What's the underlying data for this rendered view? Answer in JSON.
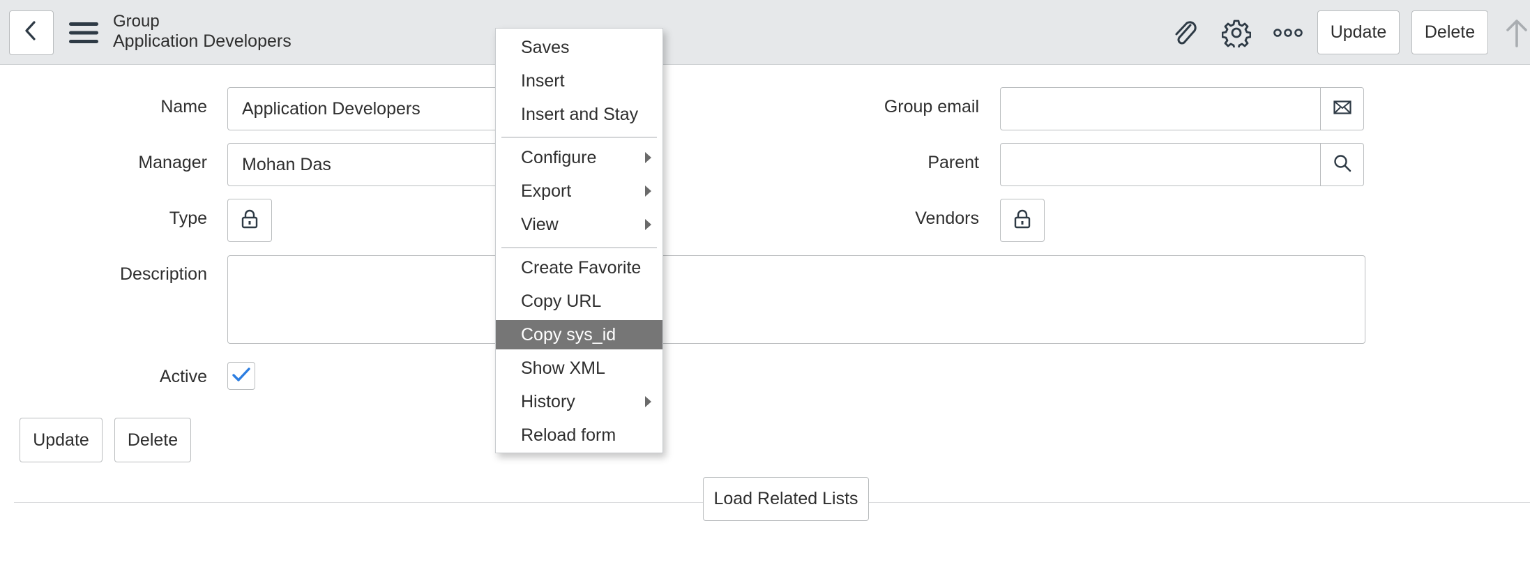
{
  "header": {
    "record_type": "Group",
    "record_name": "Application Developers",
    "update_label": "Update",
    "delete_label": "Delete"
  },
  "form": {
    "name_label": "Name",
    "name_value": "Application Developers",
    "manager_label": "Manager",
    "manager_value": "Mohan Das",
    "type_label": "Type",
    "description_label": "Description",
    "description_value": "",
    "active_label": "Active",
    "active_checked": true,
    "group_email_label": "Group email",
    "group_email_value": "",
    "parent_label": "Parent",
    "parent_value": "",
    "vendors_label": "Vendors",
    "update_label": "Update",
    "delete_label": "Delete",
    "load_related_label": "Load Related Lists"
  },
  "context_menu": {
    "items": [
      {
        "label": "Saves",
        "submenu": false,
        "highlighted": false
      },
      {
        "label": "Insert",
        "submenu": false,
        "highlighted": false
      },
      {
        "label": "Insert and Stay",
        "submenu": false,
        "highlighted": false
      },
      {
        "label": "Configure",
        "submenu": true,
        "highlighted": false
      },
      {
        "label": "Export",
        "submenu": true,
        "highlighted": false
      },
      {
        "label": "View",
        "submenu": true,
        "highlighted": false
      },
      {
        "label": "Create Favorite",
        "submenu": false,
        "highlighted": false
      },
      {
        "label": "Copy URL",
        "submenu": false,
        "highlighted": false
      },
      {
        "label": "Copy sys_id",
        "submenu": false,
        "highlighted": true
      },
      {
        "label": "Show XML",
        "submenu": false,
        "highlighted": false
      },
      {
        "label": "History",
        "submenu": true,
        "highlighted": false
      },
      {
        "label": "Reload form",
        "submenu": false,
        "highlighted": false
      }
    ]
  },
  "colors": {
    "header_bg": "#e6e8ea",
    "menu_highlight": "#767676",
    "checkbox_check": "#2b7de1"
  },
  "icons": [
    "back-icon",
    "hamburger-menu-icon",
    "paperclip-icon",
    "gear-icon",
    "more-options-icon",
    "scroll-up-arrow-icon",
    "envelope-icon",
    "search-icon",
    "lock-icon",
    "checkmark-icon",
    "submenu-arrow-icon"
  ]
}
